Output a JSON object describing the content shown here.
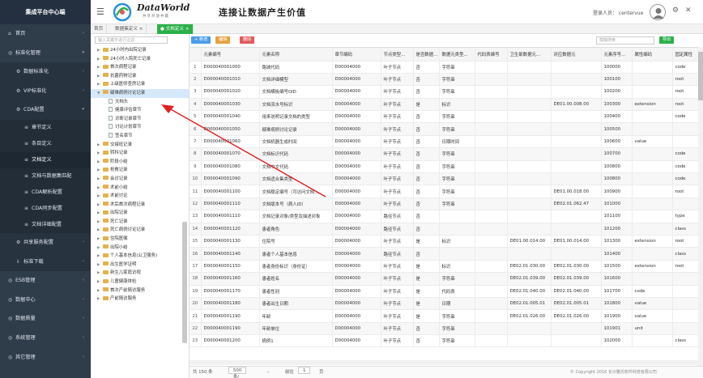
{
  "sidebar": {
    "title": "集成平台中心端",
    "items": [
      {
        "label": "首页",
        "icon": "home-icon",
        "level": 0
      },
      {
        "label": "标准化管理",
        "icon": "globe-icon",
        "level": 0,
        "expanded": true
      },
      {
        "label": "数据标准化",
        "icon": "gear-icon",
        "level": 1
      },
      {
        "label": "VIP标准化",
        "icon": "gear-icon",
        "level": 1
      },
      {
        "label": "CDA配置",
        "icon": "gear-icon",
        "level": 1,
        "expanded": true
      },
      {
        "label": "章节定义",
        "icon": "list-icon",
        "level": 2
      },
      {
        "label": "条目定义",
        "icon": "list-icon",
        "level": 2
      },
      {
        "label": "文档定义",
        "icon": "list-icon",
        "level": 2,
        "active": true
      },
      {
        "label": "文档与数据集匹配",
        "icon": "list-icon",
        "level": 2
      },
      {
        "label": "CDA解析配置",
        "icon": "list-icon",
        "level": 2
      },
      {
        "label": "CDA同步配置",
        "icon": "list-icon",
        "level": 2
      },
      {
        "label": "文档详细配置",
        "icon": "list-icon",
        "level": 2
      },
      {
        "label": "共享服务配置",
        "icon": "gear-icon",
        "level": 1
      },
      {
        "label": "标准下载",
        "icon": "download-icon",
        "level": 1
      },
      {
        "label": "ESB管理",
        "icon": "globe-icon",
        "level": 0
      },
      {
        "label": "数据中心",
        "icon": "globe-icon",
        "level": 0
      },
      {
        "label": "数据质量",
        "icon": "globe-icon",
        "level": 0
      },
      {
        "label": "系统管理",
        "icon": "globe-icon",
        "level": 0
      },
      {
        "label": "其它管理",
        "icon": "globe-icon",
        "level": 0
      }
    ]
  },
  "topbar": {
    "logo_text": "DataWorld",
    "logo_sub": "共享开放共赢",
    "slogan": "连接让数据产生价值",
    "login_label": "登录人员：",
    "login_user": "centervue"
  },
  "tabs": [
    {
      "label": "首页",
      "active": false
    },
    {
      "label": "数据集定义",
      "active": false
    },
    {
      "label": "文档定义",
      "active": true
    }
  ],
  "tree": {
    "search_placeholder": "输入关键字进行过滤",
    "nodes": [
      {
        "label": "24小时内出院记录",
        "type": "folder"
      },
      {
        "label": "24小时入院死亡记录",
        "type": "folder"
      },
      {
        "label": "首次病程记录",
        "type": "folder"
      },
      {
        "label": "抗菌药物记录",
        "type": "folder"
      },
      {
        "label": "上级医师查房记录",
        "type": "folder"
      },
      {
        "label": "疑难病例讨论记录",
        "type": "folder",
        "selected": true,
        "expanded": true
      },
      {
        "label": "文档头",
        "type": "file"
      },
      {
        "label": "健康评估章节",
        "type": "file"
      },
      {
        "label": "诊断记录章节",
        "type": "file"
      },
      {
        "label": "讨论计划章节",
        "type": "file"
      },
      {
        "label": "签名章节",
        "type": "file"
      },
      {
        "label": "交接班记录",
        "type": "folder"
      },
      {
        "label": "转科记录",
        "type": "folder"
      },
      {
        "label": "阶段小结",
        "type": "folder"
      },
      {
        "label": "抢救记录",
        "type": "folder"
      },
      {
        "label": "会诊记录",
        "type": "folder"
      },
      {
        "label": "术前小结",
        "type": "folder"
      },
      {
        "label": "术前讨论",
        "type": "folder"
      },
      {
        "label": "术后首次病程记录",
        "type": "folder"
      },
      {
        "label": "出院记录",
        "type": "folder"
      },
      {
        "label": "死亡记录",
        "type": "folder"
      },
      {
        "label": "死亡病例讨论记录",
        "type": "folder"
      },
      {
        "label": "住院医嘱",
        "type": "folder"
      },
      {
        "label": "出院小结",
        "type": "folder"
      },
      {
        "label": "个人基本信息(公卫服务)",
        "type": "folder"
      },
      {
        "label": "出生医学证明",
        "type": "folder"
      },
      {
        "label": "新生儿家庭访视",
        "type": "folder"
      },
      {
        "label": "儿童健康体检",
        "type": "folder"
      },
      {
        "label": "首次产前随访服务",
        "type": "folder"
      },
      {
        "label": "产前随访服务",
        "type": "folder"
      }
    ]
  },
  "toolbar": {
    "add_label": "+ 新增",
    "edit_label": "编辑",
    "delete_label": "删除",
    "search_placeholder": "模糊搜索",
    "export_label": "导出",
    "colors": {
      "add": "#4a9de8",
      "edit": "#e3a23c",
      "delete": "#e05a5a",
      "export": "#2bb04a"
    }
  },
  "table": {
    "columns": [
      "",
      "元素编号",
      "元素名称",
      "章节编码",
      "节点类型...",
      "是否数据...",
      "数据元类型...",
      "代码表编号",
      "卫生部数据元...",
      "对应数据元",
      "元素序号...",
      "属性编码",
      "固定属性"
    ],
    "rows": [
      [
        "1",
        "D000040001000",
        "路城代码",
        "D00004000",
        "叶子节点",
        "否",
        "字符串",
        "",
        "",
        "",
        "100000",
        "",
        "code"
      ],
      [
        "2",
        "D000040001010",
        "文档详细模型",
        "D00004000",
        "叶子节点",
        "否",
        "字符串",
        "",
        "",
        "",
        "100100",
        "",
        "root"
      ],
      [
        "3",
        "D000040001020",
        "文档模板编号OID",
        "D00004000",
        "叶子节点",
        "否",
        "字符串",
        "",
        "",
        "",
        "100200",
        "",
        "root"
      ],
      [
        "4",
        "D000040001030",
        "文档流水号标识",
        "D00004000",
        "叶子节点",
        "是",
        "标识",
        "",
        "",
        "DE01.00.008.00",
        "100300",
        "extension",
        "root"
      ],
      [
        "5",
        "D000040001040",
        "用来说明记录文档的类型",
        "D00004000",
        "叶子节点",
        "否",
        "字符串",
        "",
        "",
        "",
        "100400",
        "",
        "code"
      ],
      [
        "6",
        "D000040001050",
        "疑难病例讨论记录",
        "D00004000",
        "叶子节点",
        "否",
        "字符串",
        "",
        "",
        "",
        "100500",
        "",
        ""
      ],
      [
        "7",
        "D000040001060",
        "文档机器生成时间",
        "D00004000",
        "叶子节点",
        "否",
        "日期时间",
        "",
        "",
        "",
        "100600",
        "value",
        ""
      ],
      [
        "8",
        "D000040001070",
        "文档标识代码",
        "D00004000",
        "叶子节点",
        "否",
        "字符串",
        "",
        "",
        "",
        "100700",
        "",
        "code"
      ],
      [
        "9",
        "D000040001080",
        "文档中文代码",
        "D00004000",
        "叶子节点",
        "否",
        "字符串",
        "",
        "",
        "",
        "100800",
        "",
        "code"
      ],
      [
        "10",
        "D000040001090",
        "文档适合集类型",
        "D00004000",
        "叶子节点",
        "否",
        "字符串",
        "",
        "",
        "",
        "100800",
        "",
        "code"
      ],
      [
        "11",
        "D000040001100",
        "文档稳定编号（可访问文档...",
        "D00004000",
        "叶子节点",
        "否",
        "字符串",
        "",
        "",
        "DE01.00.018.00",
        "100900",
        "",
        "root"
      ],
      [
        "12",
        "D000040001110",
        "文档版本号（病人ID）",
        "D00004000",
        "叶子节点",
        "否",
        "字符串",
        "",
        "",
        "DE02.01.062.47",
        "101000",
        "",
        ""
      ],
      [
        "13",
        "D000040001110",
        "文档记录对象/类型及描述对象",
        "D00004000",
        "路径节点",
        "否",
        "",
        "",
        "",
        "",
        "101100",
        "",
        "type"
      ],
      [
        "14",
        "D000040001120",
        "患者角色",
        "D00004000",
        "路径节点",
        "否",
        "",
        "",
        "",
        "",
        "101200",
        "",
        "class"
      ],
      [
        "15",
        "D000040001130",
        "住院号",
        "D00004000",
        "叶子节点",
        "是",
        "标识",
        "",
        "DE01.00.014.00",
        "DE01.00.014.00",
        "101300",
        "extension",
        "root"
      ],
      [
        "16",
        "D000040001140",
        "患者个人基本信息",
        "D00004000",
        "路径节点",
        "否",
        "",
        "",
        "",
        "",
        "101400",
        "",
        "class"
      ],
      [
        "17",
        "D000040001150",
        "患者身份标识（身份证）",
        "D00004000",
        "叶子节点",
        "是",
        "标识",
        "",
        "DE02.01.030.00",
        "DE02.01.030.00",
        "101500",
        "extension",
        "root"
      ],
      [
        "18",
        "D000040001160",
        "患者姓名",
        "D00004000",
        "叶子节点",
        "是",
        "字符串",
        "",
        "DE02.01.039.00",
        "DE02.01.039.00",
        "101600",
        "",
        ""
      ],
      [
        "19",
        "D000040001170",
        "患者性别",
        "D00004000",
        "叶子节点",
        "是",
        "代码表",
        "",
        "DE02.01.040.00",
        "DE02.01.040.00",
        "101700",
        "code",
        ""
      ],
      [
        "20",
        "D000040001180",
        "患者出生日期",
        "D00004000",
        "叶子节点",
        "是",
        "日期",
        "",
        "DE02.01.005.01",
        "DE02.01.005.01",
        "101800",
        "value",
        ""
      ],
      [
        "21",
        "D000040001190",
        "年龄",
        "D00004000",
        "叶子节点",
        "是",
        "字符串",
        "",
        "DE02.01.026.00",
        "DE02.01.026.00",
        "101900",
        "value",
        ""
      ],
      [
        "22",
        "D000040001190",
        "年龄单位",
        "D00004000",
        "叶子节点",
        "否",
        "字符串",
        "",
        "",
        "",
        "101901",
        "unit",
        ""
      ],
      [
        "23",
        "D000040001200",
        "病例1",
        "D00004000",
        "叶子节点",
        "否",
        "字符串",
        "",
        "",
        "",
        "102000",
        "",
        "class"
      ]
    ]
  },
  "pager": {
    "total": "共 150 条",
    "page_size": "500条/页",
    "goto_label": "前往",
    "page_value": "1",
    "page_suffix": "页"
  },
  "footer": {
    "copyright": "© Copyright 2016 长沙雅氏软件科技有限公司"
  }
}
